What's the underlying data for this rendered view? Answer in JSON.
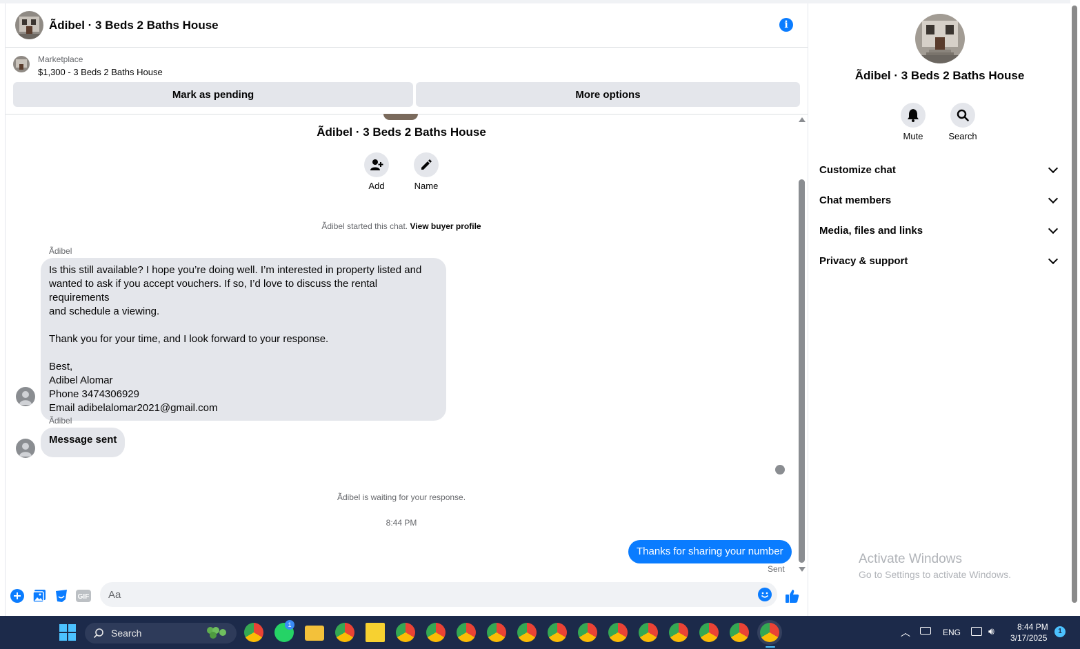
{
  "header": {
    "title": "Ãdibel · 3 Beds 2 Baths House",
    "info_icon": "info-icon"
  },
  "marketplace": {
    "label": "Marketplace",
    "listing": "$1,300 - 3 Beds 2 Baths House",
    "mark_pending": "Mark as pending",
    "more_options": "More options"
  },
  "conversation": {
    "title": "Ãdibel · 3 Beds 2 Baths House",
    "add_label": "Add",
    "name_label": "Name",
    "started_text": "Ãdibel started this chat.",
    "view_profile": "View buyer profile",
    "messages": [
      {
        "sender": "Ãdibel",
        "text": "Is this still available? I hope you’re doing well. I’m interested in property listed and\nwanted to ask if you accept vouchers. If so, I’d love to discuss the rental requirements\nand schedule a viewing.\n\nThank you for your time, and I look forward to your response.\n\nBest,\nAdibel Alomar\nPhone 3474306929\nEmail adibelalomar2021@gmail.com"
      },
      {
        "sender": "Ãdibel",
        "text": "Message sent"
      }
    ],
    "waiting_text": "Ãdibel is waiting for your response.",
    "timestamp": "8:44 PM",
    "outgoing": "Thanks for sharing your number",
    "status": "Sent"
  },
  "composer": {
    "placeholder": "Aa",
    "gif_label": "GIF"
  },
  "right_panel": {
    "title": "Ãdibel · 3 Beds 2 Baths House",
    "mute_label": "Mute",
    "search_label": "Search",
    "sections": [
      "Customize chat",
      "Chat members",
      "Media, files and links",
      "Privacy & support"
    ]
  },
  "watermark": {
    "line1": "Activate Windows",
    "line2": "Go to Settings to activate Windows."
  },
  "taskbar": {
    "search_label": "Search",
    "whatsapp_badge": "1",
    "language": "ENG",
    "time": "8:44 PM",
    "date": "3/17/2025",
    "notification_count": "1"
  },
  "colors": {
    "accent": "#0a7cff",
    "bubble_in": "#e4e6eb",
    "taskbar": "#1c2a4a"
  }
}
